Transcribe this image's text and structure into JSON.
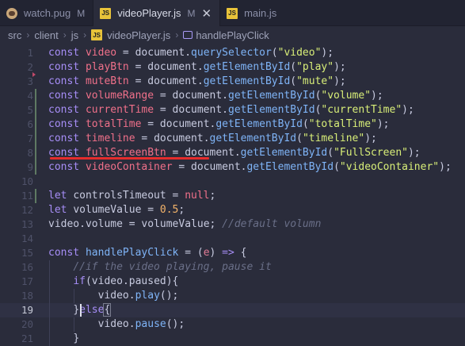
{
  "tabs": [
    {
      "label": "watch.pug",
      "status": "M",
      "icon": "pug-icon",
      "active": false
    },
    {
      "label": "videoPlayer.js",
      "status": "M",
      "icon": "js-icon",
      "active": true,
      "close": "✕"
    },
    {
      "label": "main.js",
      "status": "",
      "icon": "js-icon",
      "active": false
    }
  ],
  "breadcrumb": {
    "parts": [
      "src",
      "client",
      "js"
    ],
    "file": "videoPlayer.js",
    "symbol": "handlePlayClick",
    "js_badge": "JS"
  },
  "editor": {
    "current_line": 19,
    "lines": [
      {
        "n": "1",
        "tokens": [
          [
            "kw",
            "const "
          ],
          [
            "var",
            "video"
          ],
          [
            "plain",
            " = "
          ],
          [
            "plain",
            "document"
          ],
          [
            "dot",
            "."
          ],
          [
            "fn",
            "querySelector"
          ],
          [
            "punc",
            "("
          ],
          [
            "str",
            "\"video\""
          ],
          [
            "punc",
            ");"
          ]
        ]
      },
      {
        "n": "2",
        "tokens": [
          [
            "kw",
            "const "
          ],
          [
            "var",
            "playBtn"
          ],
          [
            "plain",
            " = "
          ],
          [
            "plain",
            "document"
          ],
          [
            "dot",
            "."
          ],
          [
            "fn",
            "getElementById"
          ],
          [
            "punc",
            "("
          ],
          [
            "str",
            "\"play\""
          ],
          [
            "punc",
            ");"
          ]
        ]
      },
      {
        "n": "3",
        "tokens": [
          [
            "kw",
            "const "
          ],
          [
            "var",
            "muteBtn"
          ],
          [
            "plain",
            " = "
          ],
          [
            "plain",
            "document"
          ],
          [
            "dot",
            "."
          ],
          [
            "fn",
            "getElementById"
          ],
          [
            "punc",
            "("
          ],
          [
            "str",
            "\"mute\""
          ],
          [
            "punc",
            ");"
          ]
        ]
      },
      {
        "n": "4",
        "tokens": [
          [
            "kw",
            "const "
          ],
          [
            "var",
            "volumeRange"
          ],
          [
            "plain",
            " = "
          ],
          [
            "plain",
            "document"
          ],
          [
            "dot",
            "."
          ],
          [
            "fn",
            "getElementById"
          ],
          [
            "punc",
            "("
          ],
          [
            "str",
            "\"volume\""
          ],
          [
            "punc",
            ");"
          ]
        ]
      },
      {
        "n": "5",
        "tokens": [
          [
            "kw",
            "const "
          ],
          [
            "var",
            "currentTime"
          ],
          [
            "plain",
            " = "
          ],
          [
            "plain",
            "document"
          ],
          [
            "dot",
            "."
          ],
          [
            "fn",
            "getElementById"
          ],
          [
            "punc",
            "("
          ],
          [
            "str",
            "\"currentTime\""
          ],
          [
            "punc",
            ");"
          ]
        ]
      },
      {
        "n": "6",
        "tokens": [
          [
            "kw",
            "const "
          ],
          [
            "var",
            "totalTime"
          ],
          [
            "plain",
            " = "
          ],
          [
            "plain",
            "document"
          ],
          [
            "dot",
            "."
          ],
          [
            "fn",
            "getElementById"
          ],
          [
            "punc",
            "("
          ],
          [
            "str",
            "\"totalTime\""
          ],
          [
            "punc",
            ");"
          ]
        ]
      },
      {
        "n": "7",
        "tokens": [
          [
            "kw",
            "const "
          ],
          [
            "var",
            "timeline"
          ],
          [
            "plain",
            " = "
          ],
          [
            "plain",
            "document"
          ],
          [
            "dot",
            "."
          ],
          [
            "fn",
            "getElementById"
          ],
          [
            "punc",
            "("
          ],
          [
            "str",
            "\"timeline\""
          ],
          [
            "punc",
            ");"
          ]
        ]
      },
      {
        "n": "8",
        "tokens": [
          [
            "kw",
            "const "
          ],
          [
            "var",
            "fullScreenBtn"
          ],
          [
            "plain",
            " = "
          ],
          [
            "plain",
            "document"
          ],
          [
            "dot",
            "."
          ],
          [
            "fn",
            "getElementById"
          ],
          [
            "punc",
            "("
          ],
          [
            "str",
            "\"FullScreen\""
          ],
          [
            "punc",
            ");"
          ]
        ]
      },
      {
        "n": "9",
        "tokens": [
          [
            "kw",
            "const "
          ],
          [
            "var",
            "videoContainer"
          ],
          [
            "plain",
            " = "
          ],
          [
            "plain",
            "document"
          ],
          [
            "dot",
            "."
          ],
          [
            "fn",
            "getElementById"
          ],
          [
            "punc",
            "("
          ],
          [
            "str",
            "\"videoContainer\""
          ],
          [
            "punc",
            ");"
          ]
        ]
      },
      {
        "n": "10",
        "tokens": []
      },
      {
        "n": "11",
        "tokens": [
          [
            "kw",
            "let "
          ],
          [
            "plain",
            "controlsTimeout"
          ],
          [
            "plain",
            " = "
          ],
          [
            "var",
            "null"
          ],
          [
            "punc",
            ";"
          ]
        ]
      },
      {
        "n": "12",
        "tokens": [
          [
            "kw",
            "let "
          ],
          [
            "plain",
            "volumeValue"
          ],
          [
            "plain",
            " = "
          ],
          [
            "num",
            "0.5"
          ],
          [
            "punc",
            ";"
          ]
        ]
      },
      {
        "n": "13",
        "tokens": [
          [
            "plain",
            "video"
          ],
          [
            "dot",
            "."
          ],
          [
            "plain",
            "volume"
          ],
          [
            "plain",
            " = "
          ],
          [
            "plain",
            "volumeValue"
          ],
          [
            "punc",
            "; "
          ],
          [
            "cmt",
            "//default volumn"
          ]
        ]
      },
      {
        "n": "14",
        "tokens": []
      },
      {
        "n": "15",
        "tokens": [
          [
            "kw",
            "const "
          ],
          [
            "fn",
            "handlePlayClick"
          ],
          [
            "plain",
            " = "
          ],
          [
            "punc",
            "("
          ],
          [
            "param",
            "e"
          ],
          [
            "punc",
            ") "
          ],
          [
            "kw",
            "=>"
          ],
          [
            "punc",
            " {"
          ]
        ]
      },
      {
        "n": "16",
        "tokens": [
          [
            "plain",
            "    "
          ],
          [
            "cmt",
            "//if the video playing, pause it"
          ]
        ]
      },
      {
        "n": "17",
        "tokens": [
          [
            "plain",
            "    "
          ],
          [
            "kw",
            "if"
          ],
          [
            "punc",
            "("
          ],
          [
            "plain",
            "video"
          ],
          [
            "dot",
            "."
          ],
          [
            "plain",
            "paused"
          ],
          [
            "punc",
            "){"
          ]
        ]
      },
      {
        "n": "18",
        "tokens": [
          [
            "plain",
            "        "
          ],
          [
            "plain",
            "video"
          ],
          [
            "dot",
            "."
          ],
          [
            "fn",
            "play"
          ],
          [
            "punc",
            "();"
          ]
        ]
      },
      {
        "n": "19",
        "tokens": [
          [
            "plain",
            "    "
          ],
          [
            "punc",
            "}"
          ],
          [
            "kw",
            "else"
          ],
          [
            "punc",
            "{"
          ]
        ]
      },
      {
        "n": "20",
        "tokens": [
          [
            "plain",
            "        "
          ],
          [
            "plain",
            "video"
          ],
          [
            "dot",
            "."
          ],
          [
            "fn",
            "pause"
          ],
          [
            "punc",
            "();"
          ]
        ]
      },
      {
        "n": "21",
        "tokens": [
          [
            "plain",
            "    "
          ],
          [
            "punc",
            "}"
          ]
        ]
      }
    ]
  }
}
